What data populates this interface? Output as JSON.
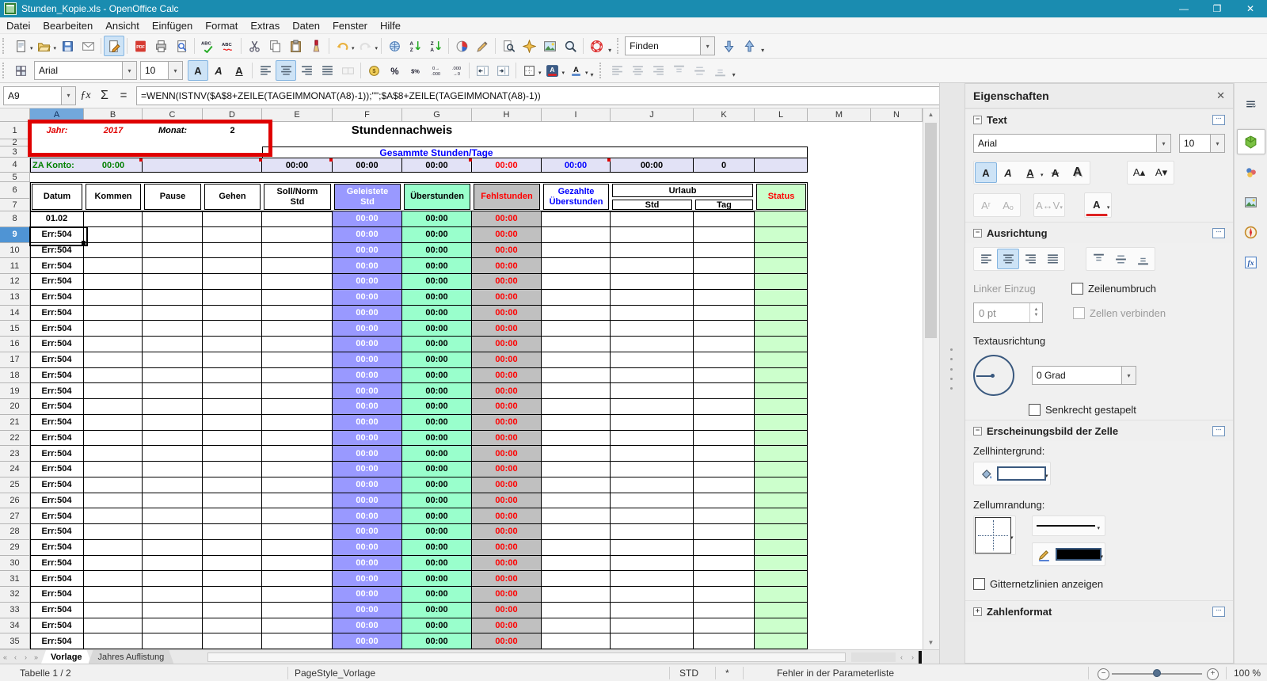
{
  "window": {
    "title": "Stunden_Kopie.xls - OpenOffice Calc",
    "controls": [
      "minimize",
      "restore",
      "close"
    ]
  },
  "menubar": [
    "Datei",
    "Bearbeiten",
    "Ansicht",
    "Einfügen",
    "Format",
    "Extras",
    "Daten",
    "Fenster",
    "Hilfe"
  ],
  "toolbars": {
    "standard": [
      {
        "icon": "new-document",
        "dropdown": true
      },
      {
        "icon": "open",
        "dropdown": true
      },
      {
        "icon": "save"
      },
      {
        "icon": "email"
      },
      {
        "sep": true
      },
      {
        "icon": "edit-file",
        "active": true
      },
      {
        "sep": true
      },
      {
        "icon": "export-pdf"
      },
      {
        "icon": "print"
      },
      {
        "icon": "page-preview"
      },
      {
        "sep": true
      },
      {
        "icon": "spellcheck"
      },
      {
        "icon": "auto-spellcheck"
      },
      {
        "sep": true
      },
      {
        "icon": "cut"
      },
      {
        "icon": "copy"
      },
      {
        "icon": "paste"
      },
      {
        "icon": "clone-formatting"
      },
      {
        "sep": true
      },
      {
        "icon": "undo",
        "dropdown": true
      },
      {
        "icon": "redo",
        "dropdown": true,
        "disabled": true
      },
      {
        "sep": true
      },
      {
        "icon": "hyperlink"
      },
      {
        "icon": "sort-ascending"
      },
      {
        "icon": "sort-descending"
      },
      {
        "sep": true
      },
      {
        "icon": "insert-chart"
      },
      {
        "icon": "draw-functions"
      },
      {
        "sep": true
      },
      {
        "icon": "find-replace"
      },
      {
        "icon": "navigator"
      },
      {
        "icon": "gallery"
      },
      {
        "icon": "zoom"
      },
      {
        "sep": true
      },
      {
        "icon": "help"
      }
    ],
    "find": {
      "value": "Finden",
      "buttons": [
        "find-down",
        "find-up"
      ]
    },
    "formatting": {
      "font_name": "Arial",
      "font_size": "10",
      "buttons": [
        {
          "icon": "bold",
          "active": true
        },
        {
          "icon": "italic"
        },
        {
          "icon": "underline"
        },
        {
          "sep": true
        },
        {
          "icon": "align-left"
        },
        {
          "icon": "align-center",
          "active": true
        },
        {
          "icon": "align-right"
        },
        {
          "icon": "align-justify"
        },
        {
          "icon": "merge-cells",
          "disabled": true
        },
        {
          "sep": true
        },
        {
          "icon": "currency"
        },
        {
          "icon": "percent"
        },
        {
          "icon": "number-standard"
        },
        {
          "icon": "add-decimal"
        },
        {
          "icon": "remove-decimal"
        },
        {
          "sep": true
        },
        {
          "icon": "decrease-indent"
        },
        {
          "icon": "increase-indent"
        },
        {
          "sep": true
        },
        {
          "icon": "borders",
          "dropdown": true
        },
        {
          "icon": "font-color",
          "dropdown": true
        },
        {
          "icon": "background-color",
          "dropdown": true
        }
      ],
      "disabled_group": [
        "align-left",
        "align-center",
        "align-right",
        "align-top",
        "align-middle",
        "align-bottom"
      ]
    }
  },
  "formula_bar": {
    "cell_reference": "A9",
    "buttons": [
      "function-wizard",
      "sum",
      "formula"
    ],
    "formula": "=WENN(ISTNV($A$8+ZEILE(TAGEIMMONAT(A8)-1));\"\";$A$8+ZEILE(TAGEIMMONAT(A8)-1))"
  },
  "spreadsheet": {
    "column_headers": [
      "A",
      "B",
      "C",
      "D",
      "E",
      "F",
      "G",
      "H",
      "I",
      "J",
      "K",
      "L",
      "M",
      "N"
    ],
    "selected_column": "A",
    "selected_row": "9",
    "header_info": {
      "jahr_label": "Jahr:",
      "jahr_value": "2017",
      "monat_label": "Monat:",
      "monat_value": "2",
      "title": "Stundennachweis",
      "summary_title": "Gesammte Stunden/Tage",
      "za_konto_label": "ZA Konto:",
      "za_konto_value": "00:00",
      "summary_values": [
        {
          "col": "E",
          "value": "00:00",
          "color": "#000000"
        },
        {
          "col": "F",
          "value": "00:00",
          "color": "#000000"
        },
        {
          "col": "G",
          "value": "00:00",
          "color": "#000000"
        },
        {
          "col": "H",
          "value": "00:00",
          "color": "#ff0000"
        },
        {
          "col": "I",
          "value": "00:00",
          "color": "#0000ff"
        },
        {
          "col": "J",
          "value": "00:00",
          "color": "#000000"
        },
        {
          "col": "K",
          "value": "0",
          "color": "#000000"
        }
      ],
      "comment_cells": [
        "B4",
        "D4",
        "E4",
        "G4",
        "I4"
      ]
    },
    "table_headers": {
      "datum": "Datum",
      "kommen": "Kommen",
      "pause": "Pause",
      "gehen": "Gehen",
      "soll": "Soll/Norm Std",
      "geleistete": "Geleistete Std",
      "ueberstunden": "Überstunden",
      "fehlstunden": "Fehlstunden",
      "gezahlte": "Gezahlte Überstunden",
      "urlaub": "Urlaub",
      "urlaub_std": "Std",
      "urlaub_tag": "Tag",
      "status": "Status"
    },
    "rows": [
      {
        "nr": "8",
        "datum": "01.02",
        "geleistete": "00:00",
        "ueberstunden": "00:00",
        "fehlstunden": "00:00"
      },
      {
        "nr": "9",
        "datum": "Err:504",
        "geleistete": "00:00",
        "ueberstunden": "00:00",
        "fehlstunden": "00:00"
      },
      {
        "nr": "10",
        "datum": "Err:504",
        "geleistete": "00:00",
        "ueberstunden": "00:00",
        "fehlstunden": "00:00"
      },
      {
        "nr": "11",
        "datum": "Err:504",
        "geleistete": "00:00",
        "ueberstunden": "00:00",
        "fehlstunden": "00:00"
      },
      {
        "nr": "12",
        "datum": "Err:504",
        "geleistete": "00:00",
        "ueberstunden": "00:00",
        "fehlstunden": "00:00"
      },
      {
        "nr": "13",
        "datum": "Err:504",
        "geleistete": "00:00",
        "ueberstunden": "00:00",
        "fehlstunden": "00:00"
      },
      {
        "nr": "14",
        "datum": "Err:504",
        "geleistete": "00:00",
        "ueberstunden": "00:00",
        "fehlstunden": "00:00"
      },
      {
        "nr": "15",
        "datum": "Err:504",
        "geleistete": "00:00",
        "ueberstunden": "00:00",
        "fehlstunden": "00:00"
      },
      {
        "nr": "16",
        "datum": "Err:504",
        "geleistete": "00:00",
        "ueberstunden": "00:00",
        "fehlstunden": "00:00"
      },
      {
        "nr": "17",
        "datum": "Err:504",
        "geleistete": "00:00",
        "ueberstunden": "00:00",
        "fehlstunden": "00:00"
      },
      {
        "nr": "18",
        "datum": "Err:504",
        "geleistete": "00:00",
        "ueberstunden": "00:00",
        "fehlstunden": "00:00"
      },
      {
        "nr": "19",
        "datum": "Err:504",
        "geleistete": "00:00",
        "ueberstunden": "00:00",
        "fehlstunden": "00:00"
      },
      {
        "nr": "20",
        "datum": "Err:504",
        "geleistete": "00:00",
        "ueberstunden": "00:00",
        "fehlstunden": "00:00"
      },
      {
        "nr": "21",
        "datum": "Err:504",
        "geleistete": "00:00",
        "ueberstunden": "00:00",
        "fehlstunden": "00:00"
      },
      {
        "nr": "22",
        "datum": "Err:504",
        "geleistete": "00:00",
        "ueberstunden": "00:00",
        "fehlstunden": "00:00"
      },
      {
        "nr": "23",
        "datum": "Err:504",
        "geleistete": "00:00",
        "ueberstunden": "00:00",
        "fehlstunden": "00:00"
      },
      {
        "nr": "24",
        "datum": "Err:504",
        "geleistete": "00:00",
        "ueberstunden": "00:00",
        "fehlstunden": "00:00"
      },
      {
        "nr": "25",
        "datum": "Err:504",
        "geleistete": "00:00",
        "ueberstunden": "00:00",
        "fehlstunden": "00:00"
      },
      {
        "nr": "26",
        "datum": "Err:504",
        "geleistete": "00:00",
        "ueberstunden": "00:00",
        "fehlstunden": "00:00"
      },
      {
        "nr": "27",
        "datum": "Err:504",
        "geleistete": "00:00",
        "ueberstunden": "00:00",
        "fehlstunden": "00:00"
      },
      {
        "nr": "28",
        "datum": "Err:504",
        "geleistete": "00:00",
        "ueberstunden": "00:00",
        "fehlstunden": "00:00"
      },
      {
        "nr": "29",
        "datum": "Err:504",
        "geleistete": "00:00",
        "ueberstunden": "00:00",
        "fehlstunden": "00:00"
      },
      {
        "nr": "30",
        "datum": "Err:504",
        "geleistete": "00:00",
        "ueberstunden": "00:00",
        "fehlstunden": "00:00"
      },
      {
        "nr": "31",
        "datum": "Err:504",
        "geleistete": "00:00",
        "ueberstunden": "00:00",
        "fehlstunden": "00:00"
      },
      {
        "nr": "32",
        "datum": "Err:504",
        "geleistete": "00:00",
        "ueberstunden": "00:00",
        "fehlstunden": "00:00"
      },
      {
        "nr": "33",
        "datum": "Err:504",
        "geleistete": "00:00",
        "ueberstunden": "00:00",
        "fehlstunden": "00:00"
      },
      {
        "nr": "34",
        "datum": "Err:504",
        "geleistete": "00:00",
        "ueberstunden": "00:00",
        "fehlstunden": "00:00"
      },
      {
        "nr": "35",
        "datum": "Err:504",
        "geleistete": "00:00",
        "ueberstunden": "00:00",
        "fehlstunden": "00:00"
      }
    ]
  },
  "sheet_tabs": {
    "tabs": [
      {
        "label": "Vorlage",
        "active": true
      },
      {
        "label": "Jahres Auflistung",
        "active": false
      }
    ]
  },
  "status_bar": {
    "sheet_info": "Tabelle 1 / 2",
    "page_style": "PageStyle_Vorlage",
    "selection_mode": "STD",
    "modified_flag": "*",
    "message": "Fehler in der Parameterliste",
    "zoom_level": "100 %"
  },
  "sidebar": {
    "title": "Eigenschaften",
    "decks": [
      "sidebar-menu",
      "properties",
      "styles",
      "gallery",
      "navigator",
      "functions"
    ],
    "text_section": {
      "title": "Text",
      "font_name": "Arial",
      "font_size": "10"
    },
    "alignment_section": {
      "title": "Ausrichtung",
      "left_indent_label": "Linker Einzug",
      "left_indent_value": "0 pt",
      "wrap_label": "Zeilenumbruch",
      "merge_label": "Zellen verbinden",
      "orientation_label": "Textausrichtung",
      "rotation_value": "0 Grad",
      "stacked_label": "Senkrecht gestapelt"
    },
    "appearance_section": {
      "title": "Erscheinungsbild der Zelle",
      "background_label": "Zellhintergrund:",
      "border_label": "Zellumrandung:",
      "gridlines_label": "Gitternetzlinien anzeigen"
    },
    "number_section": {
      "title": "Zahlenformat"
    }
  },
  "colors": {
    "titlebar": "#1a8cb0",
    "purple_column": "#9999ff",
    "green_column": "#99ffcc",
    "gray_column": "#c0c0c0",
    "status_column": "#ccffcc",
    "summary_row": "#e2e2f6",
    "error_red": "#ff0000",
    "label_green": "#008000",
    "label_blue": "#0000ff",
    "range_border": "#df0000"
  }
}
